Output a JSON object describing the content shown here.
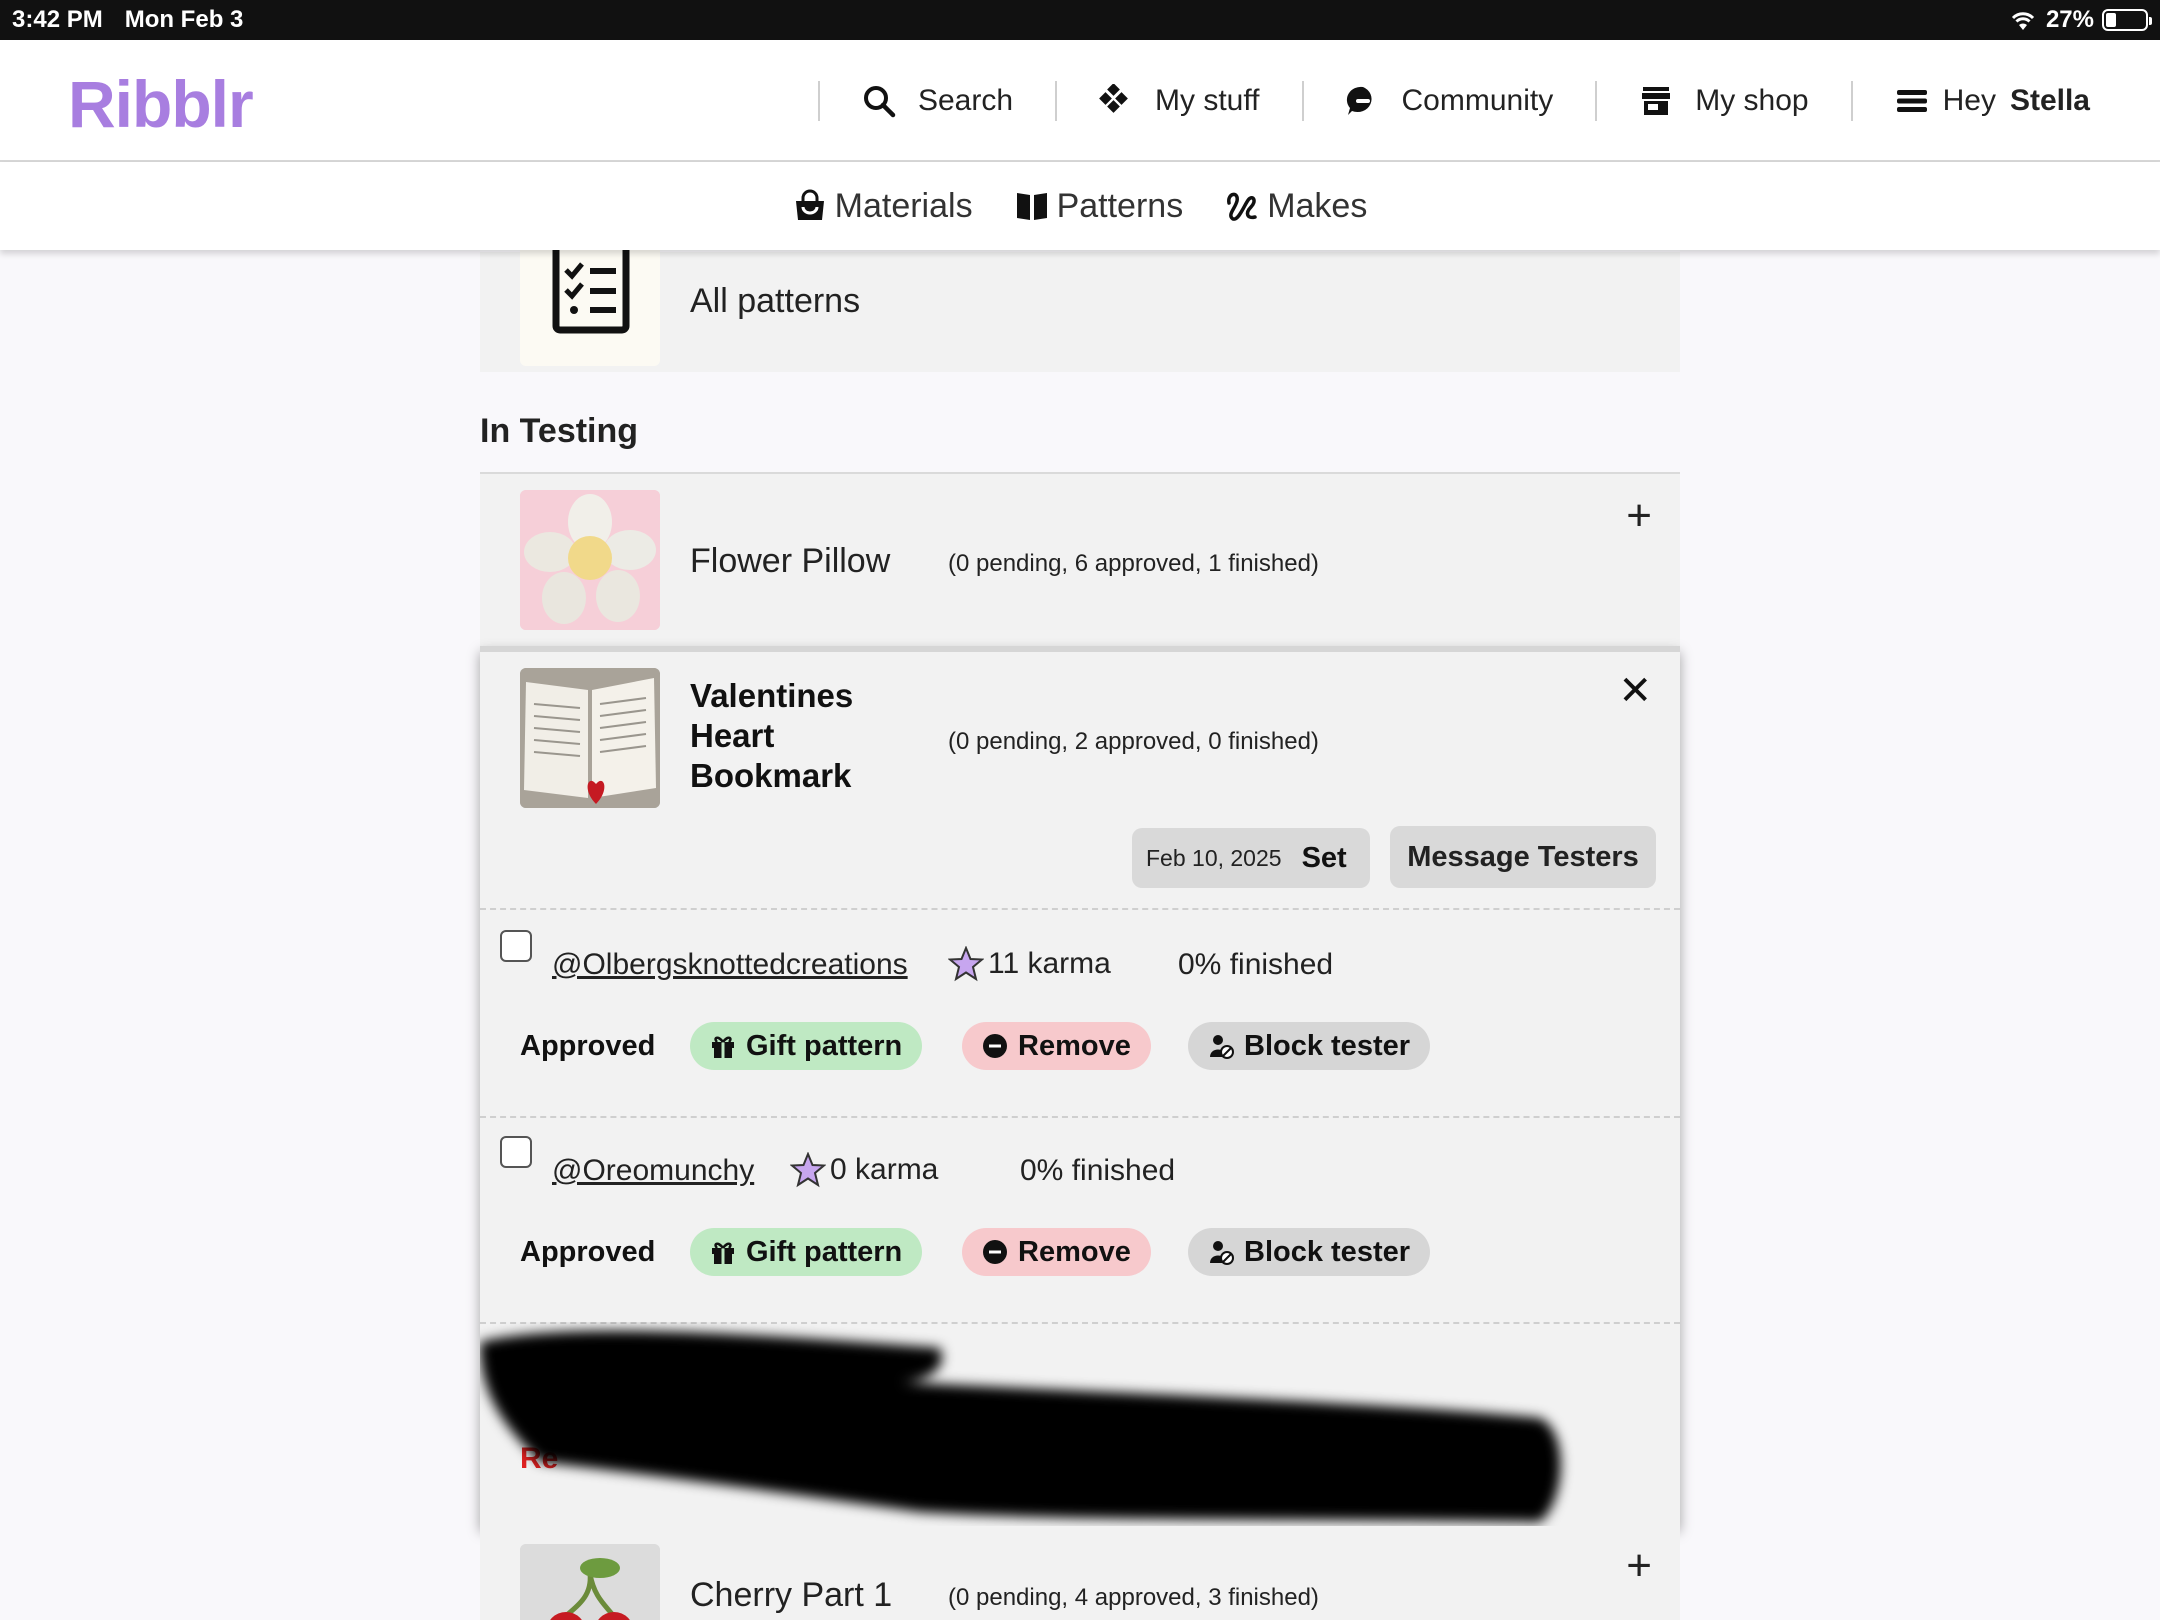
{
  "status_bar": {
    "time": "3:42 PM",
    "date": "Mon Feb 3",
    "battery": "27%"
  },
  "brand": {
    "logo": "Ribblr",
    "accent_color": "#a87ee0"
  },
  "nav": {
    "search": "Search",
    "my_stuff": "My stuff",
    "community": "Community",
    "my_shop": "My shop",
    "greeting": "Hey",
    "user_name": "Stella"
  },
  "subnav": {
    "materials": "Materials",
    "patterns": "Patterns",
    "makes": "Makes"
  },
  "all_patterns": {
    "title": "All patterns"
  },
  "section": {
    "heading": "In Testing"
  },
  "patterns": {
    "flower": {
      "title": "Flower Pillow",
      "counts": "(0 pending, 6 approved, 1 finished)"
    },
    "valentines": {
      "title_line1": "Valentines",
      "title_line2": "Heart",
      "title_line3": "Bookmark",
      "counts": "(0 pending, 2 approved, 0 finished)",
      "deadline": "Feb 10, 2025",
      "set_label": "Set",
      "message_label": "Message Testers"
    },
    "cherry": {
      "title": "Cherry Part 1",
      "counts": "(0 pending, 4 approved, 3 finished)"
    }
  },
  "testers": [
    {
      "handle": "@Olbergsknottedcreations",
      "karma": "11 karma",
      "finished": "0% finished",
      "status": "Approved"
    },
    {
      "handle": "@Oreomunchy",
      "karma": "0 karma",
      "finished": "0% finished",
      "status": "Approved"
    }
  ],
  "actions": {
    "gift": "Gift pattern",
    "remove": "Remove",
    "block": "Block tester"
  },
  "redacted_row": {
    "status_fragment": "Re"
  }
}
